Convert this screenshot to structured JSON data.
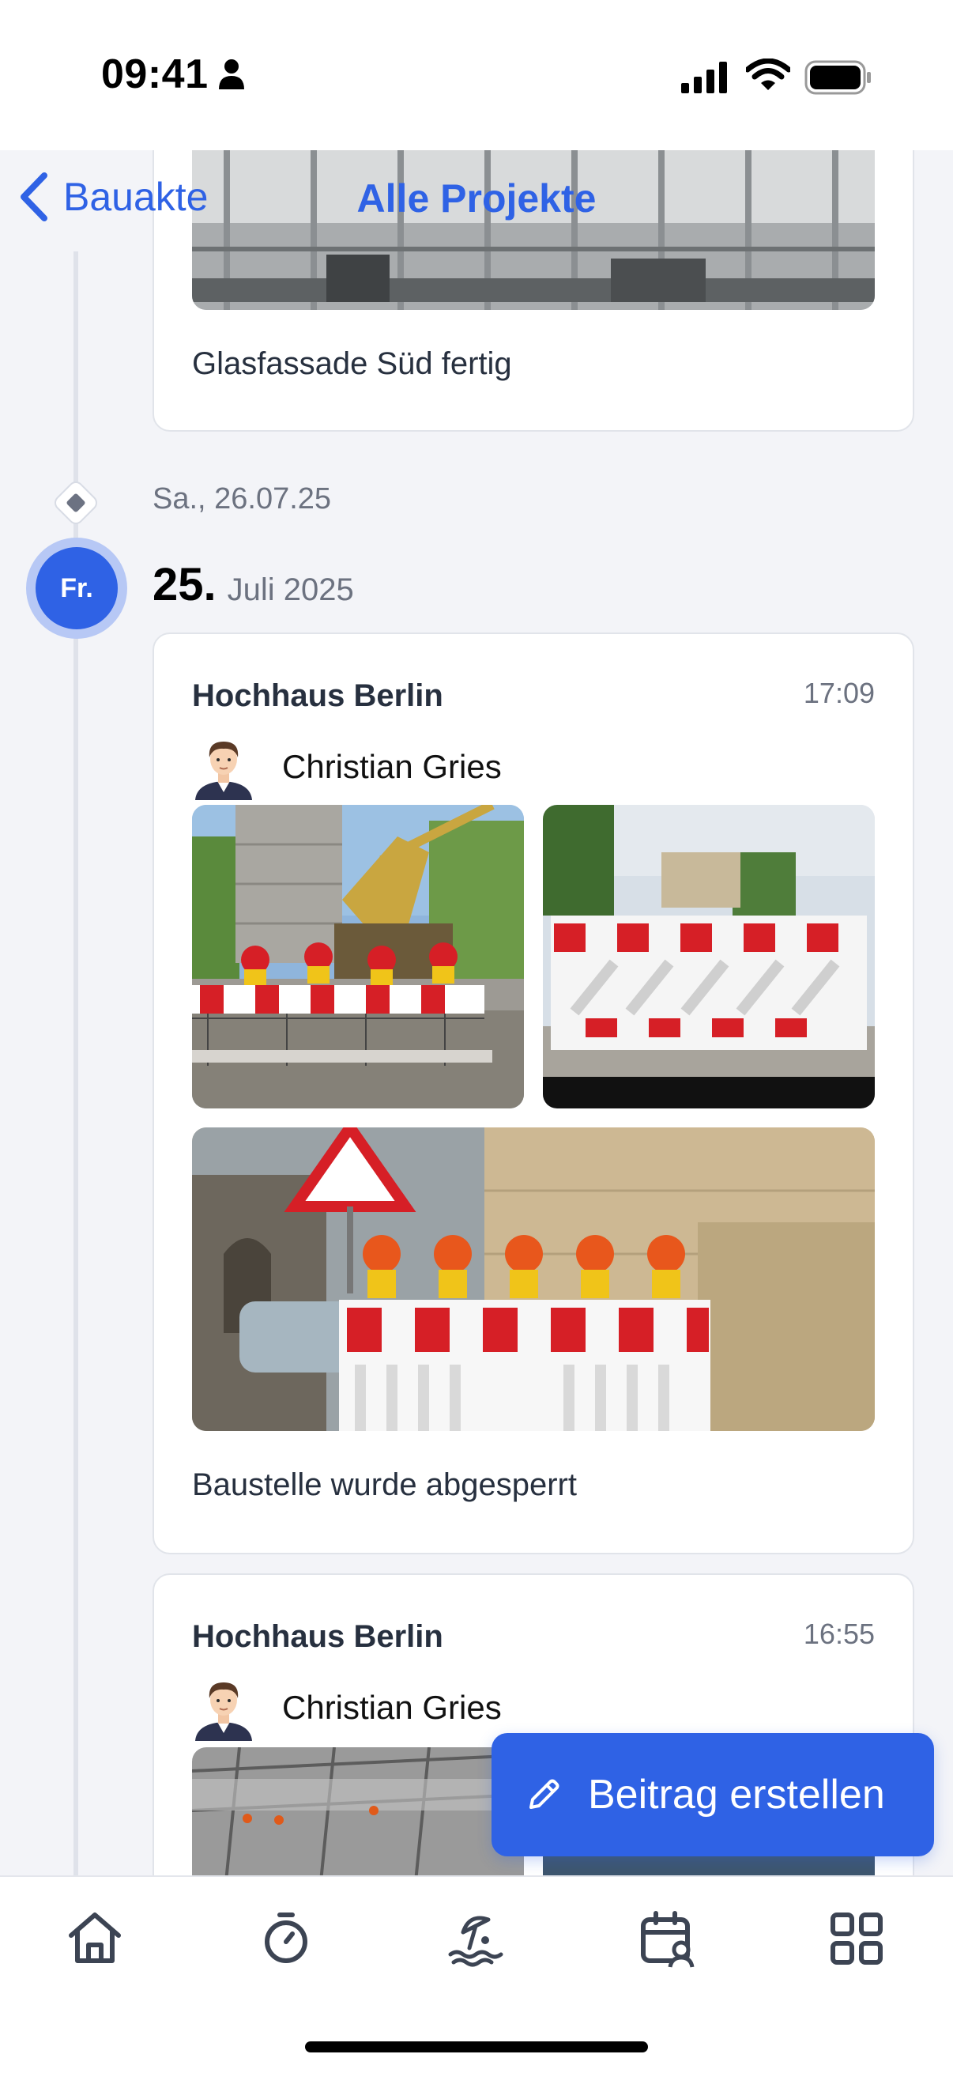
{
  "status_bar": {
    "time": "09:41"
  },
  "nav": {
    "back_label": "Bauakte",
    "title": "Alle Projekte"
  },
  "timeline": {
    "previous_card_text": "Glasfassade Süd fertig",
    "empty_day_label": "Sa., 26.07.25",
    "active_day_abbrev": "Fr.",
    "active_day_number": "25.",
    "active_month_year": "Juli 2025"
  },
  "posts": [
    {
      "project": "Hochhaus Berlin",
      "time": "17:09",
      "author": "Christian Gries",
      "text": "Baustelle wurde abgesperrt"
    },
    {
      "project": "Hochhaus Berlin",
      "time": "16:55",
      "author": "Christian Gries"
    }
  ],
  "fab": {
    "label": "Beitrag erstellen"
  },
  "tab_bar": {
    "items": [
      {
        "icon": "home-icon"
      },
      {
        "icon": "stopwatch-icon"
      },
      {
        "icon": "beach-vacation-icon"
      },
      {
        "icon": "calendar-user-icon"
      },
      {
        "icon": "grid-icon"
      }
    ]
  },
  "colors": {
    "accent": "#2f62e5",
    "background": "#f3f4f8"
  }
}
